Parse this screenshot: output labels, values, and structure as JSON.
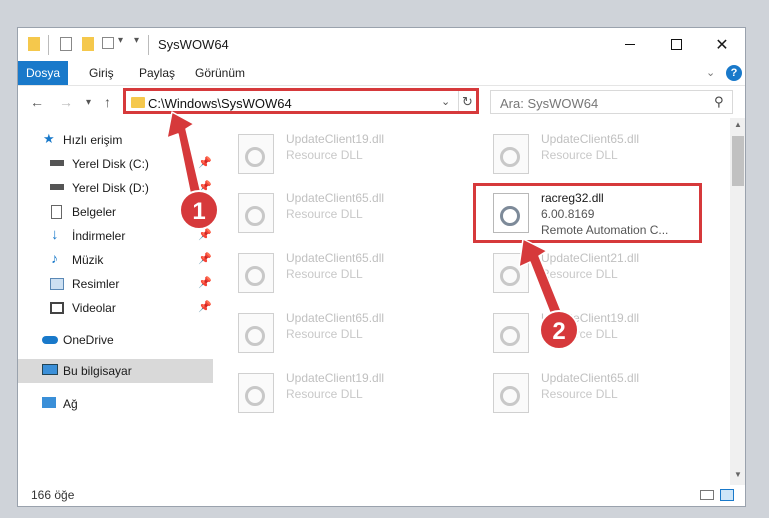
{
  "window": {
    "title": "SysWOW64"
  },
  "ribbon": {
    "tabs": [
      "Dosya",
      "Giriş",
      "Paylaş",
      "Görünüm"
    ]
  },
  "address": {
    "path": "C:\\Windows\\SysWOW64",
    "search_placeholder": "Ara: SysWOW64"
  },
  "sidebar": {
    "quick_access": "Hızlı erişim",
    "items": [
      {
        "label": "Yerel Disk (C:)",
        "icon": "drive-icon",
        "pinned": true
      },
      {
        "label": "Yerel Disk (D:)",
        "icon": "drive-icon",
        "pinned": true
      },
      {
        "label": "Belgeler",
        "icon": "documents-icon",
        "pinned": true
      },
      {
        "label": "İndirmeler",
        "icon": "download-icon",
        "pinned": true
      },
      {
        "label": "Müzik",
        "icon": "music-icon",
        "pinned": true
      },
      {
        "label": "Resimler",
        "icon": "pictures-icon",
        "pinned": true
      },
      {
        "label": "Videolar",
        "icon": "videos-icon",
        "pinned": true
      }
    ],
    "onedrive": "OneDrive",
    "this_pc": "Bu bilgisayar",
    "network": "Ağ"
  },
  "files": [
    {
      "name": "UpdateClient19.dll",
      "desc": "Resource DLL"
    },
    {
      "name": "UpdateClient65.dll",
      "desc": "Resource DLL"
    },
    {
      "name": "UpdateClient65.dll",
      "desc": "Resource DLL"
    },
    {
      "name": "racreg32.dll",
      "version": "6.00.8169",
      "desc": "Remote Automation C...",
      "highlighted": true
    },
    {
      "name": "UpdateClient65.dll",
      "desc": "Resource DLL"
    },
    {
      "name": "UpdateClient21.dll",
      "desc": "Resource DLL"
    },
    {
      "name": "UpdateClient65.dll",
      "desc": "Resource DLL"
    },
    {
      "name": "UpdateClient19.dll",
      "desc": "Resource DLL"
    },
    {
      "name": "UpdateClient19.dll",
      "desc": "Resource DLL"
    },
    {
      "name": "UpdateClient65.dll",
      "desc": "Resource DLL"
    }
  ],
  "status": {
    "count": "166 öğe"
  },
  "callouts": [
    "1",
    "2"
  ],
  "colors": {
    "accent": "#1979ca",
    "highlight": "#d6393b"
  }
}
